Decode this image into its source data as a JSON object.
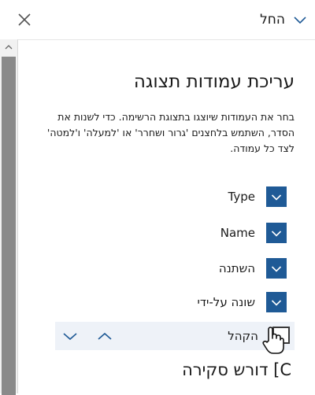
{
  "header": {
    "apply_label": "החל",
    "close_icon": "close-icon",
    "chevron_icon": "chevron-down-icon"
  },
  "panel": {
    "title": "עריכת עמודות תצוגה",
    "description": "בחר את העמודות שיוצגו בתצוגת הרשימה. כדי לשנות את הסדר, השתמש בלחצנים 'גרור ושחרר' או 'למעלה' ו'למטה' לצד כל עמודה."
  },
  "columns": [
    {
      "label": "Type",
      "checked": true
    },
    {
      "label": "Name",
      "checked": true
    },
    {
      "label": "השתנה",
      "checked": true
    },
    {
      "label": "שונה על-ידי",
      "checked": true
    },
    {
      "label": "הקהל",
      "checked": false
    }
  ],
  "partial_item": "C] דורש סקירה",
  "colors": {
    "checkbox_blue": "#1f5a96",
    "highlight": "#eef2f8",
    "scroll_thumb": "#8a8a8a"
  }
}
